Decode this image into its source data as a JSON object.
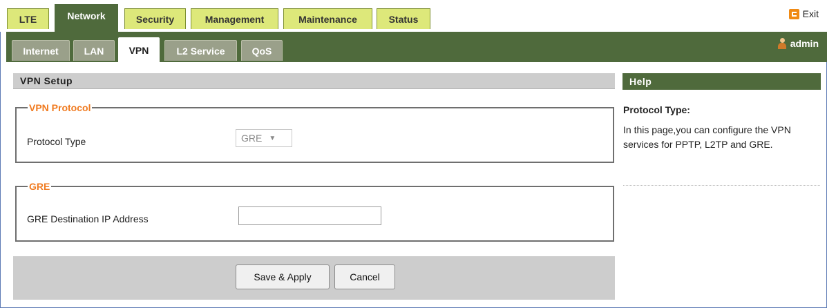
{
  "top_tabs": [
    "LTE",
    "Network",
    "Security",
    "Management",
    "Maintenance",
    "Status"
  ],
  "active_top_tab": "Network",
  "exit_label": "Exit",
  "sub_tabs": [
    "Internet",
    "LAN",
    "VPN",
    "L2 Service",
    "QoS"
  ],
  "active_sub_tab": "VPN",
  "user_label": "admin",
  "main": {
    "section_title": "VPN Setup",
    "vpn_protocol": {
      "legend": "VPN Protocol",
      "protocol_type_label": "Protocol Type",
      "protocol_type_value": "GRE"
    },
    "gre": {
      "legend": "GRE",
      "dest_ip_label": "GRE Destination IP Address",
      "dest_ip_value": ""
    },
    "save_label": "Save & Apply",
    "cancel_label": "Cancel"
  },
  "help": {
    "header": "Help",
    "title": "Protocol Type:",
    "text": "In this page,you can configure the VPN services for PPTP, L2TP and GRE."
  },
  "colors": {
    "tab_bg": "#dde87a",
    "nav_dark": "#4f6a3c",
    "legend_orange": "#f07a1f",
    "section_gray": "#cdcdcd"
  }
}
